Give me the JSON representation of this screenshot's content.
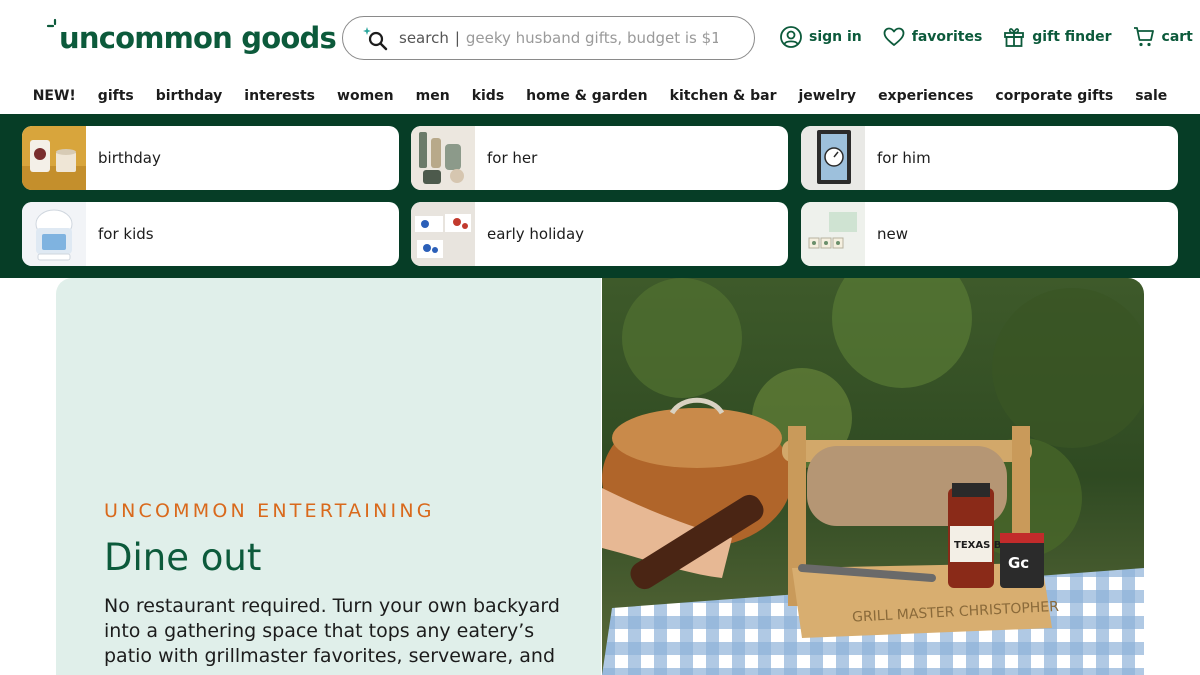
{
  "header": {
    "logo_text": "uncommon goods",
    "search": {
      "label": "search",
      "separator": "|",
      "placeholder": "geeky husband gifts, budget is $1..."
    },
    "util": [
      {
        "label": "sign in",
        "icon": "user-circle-icon"
      },
      {
        "label": "favorites",
        "icon": "heart-icon"
      },
      {
        "label": "gift finder",
        "icon": "gift-icon"
      },
      {
        "label": "cart",
        "icon": "cart-icon"
      }
    ]
  },
  "nav": {
    "categories": [
      "NEW!",
      "gifts",
      "birthday",
      "interests",
      "women",
      "men",
      "kids",
      "home & garden",
      "kitchen & bar",
      "jewelry",
      "experiences",
      "corporate gifts",
      "sale"
    ]
  },
  "tiles": [
    {
      "label": "birthday"
    },
    {
      "label": "for her"
    },
    {
      "label": "for him"
    },
    {
      "label": "for kids"
    },
    {
      "label": "early holiday"
    },
    {
      "label": "new"
    }
  ],
  "hero": {
    "eyebrow": "UNCOMMON ENTERTAINING",
    "title": "Dine out",
    "body": "No restaurant required. Turn your own backyard into a gathering space that tops any eatery’s patio with grillmaster favorites, serveware, and",
    "image_caption_sauce": "TEXAS BBQ",
    "image_caption_jar": "Gc",
    "image_caption_engraving": "GRILL MASTER CHRISTOPHER"
  },
  "colors": {
    "brand_green": "#0c5a3b",
    "band_green": "#063d26",
    "hero_bg": "#e0efea",
    "accent_orange": "#d9691c"
  }
}
